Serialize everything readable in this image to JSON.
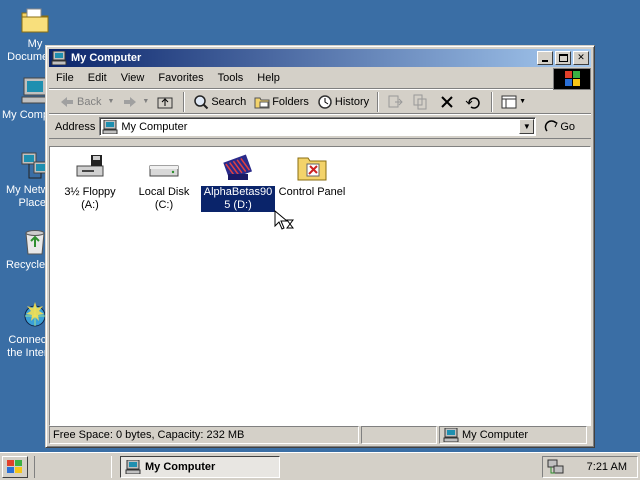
{
  "desktop": {
    "icons": [
      {
        "label": "My Documents",
        "icon": "folder-documents-icon"
      },
      {
        "label": "My Computer",
        "icon": "computer-icon"
      },
      {
        "label": "My Network\nPlaces",
        "icon": "network-icon"
      },
      {
        "label": "Recycle Bin",
        "icon": "recycle-bin-icon"
      },
      {
        "label": "Connect to\nthe Internet",
        "icon": "connect-internet-icon"
      }
    ]
  },
  "window": {
    "title": "My Computer",
    "menu": [
      "File",
      "Edit",
      "View",
      "Favorites",
      "Tools",
      "Help"
    ],
    "toolbar": {
      "back": "Back",
      "search": "Search",
      "folders": "Folders",
      "history": "History"
    },
    "address": {
      "label": "Address",
      "value": "My Computer",
      "go": "Go"
    },
    "items": [
      {
        "label": "3½ Floppy\n(A:)",
        "icon": "floppy-drive-icon",
        "selected": false
      },
      {
        "label": "Local Disk (C:)",
        "icon": "hard-disk-icon",
        "selected": false
      },
      {
        "label": "AlphaBetas90\n5 (D:)",
        "icon": "cd-drive-icon",
        "selected": true
      },
      {
        "label": "Control Panel",
        "icon": "control-panel-icon",
        "selected": false
      }
    ],
    "status": {
      "info": "Free Space: 0 bytes, Capacity: 232 MB",
      "zone": "My Computer"
    }
  },
  "taskbar": {
    "task": "My Computer",
    "time": "7:21 AM"
  },
  "colors": {
    "desktop": "#3a6ea5",
    "titlebar": "#0a246a",
    "face": "#d4d0c8",
    "selection": "#0a246a"
  }
}
